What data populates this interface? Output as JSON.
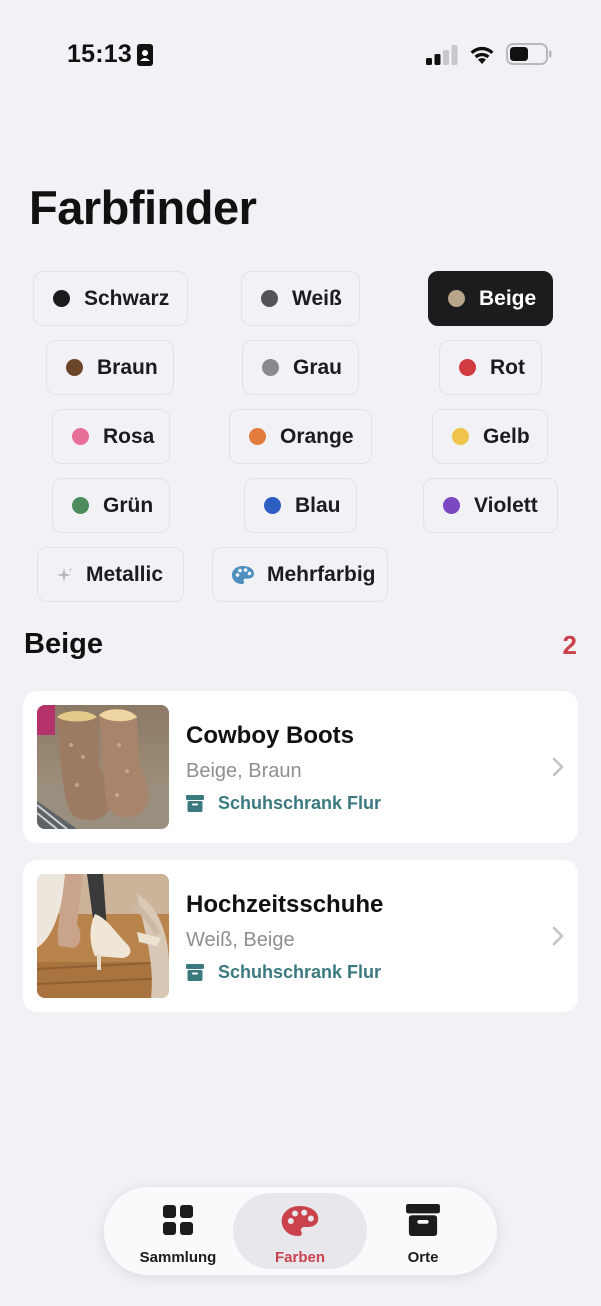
{
  "status_bar": {
    "time": "15:13"
  },
  "title": "Farbfinder",
  "colors": [
    {
      "label": "Schwarz",
      "dot": "#1c1c1e",
      "selected": false
    },
    {
      "label": "Weiß",
      "dot": "#545458",
      "selected": false
    },
    {
      "label": "Beige",
      "dot": "#b8a58a",
      "selected": true
    },
    {
      "label": "Braun",
      "dot": "#6a4528",
      "selected": false
    },
    {
      "label": "Grau",
      "dot": "#8a8a8e",
      "selected": false
    },
    {
      "label": "Rot",
      "dot": "#d13a3f",
      "selected": false
    },
    {
      "label": "Rosa",
      "dot": "#e76f9a",
      "selected": false
    },
    {
      "label": "Orange",
      "dot": "#e27b3b",
      "selected": false
    },
    {
      "label": "Gelb",
      "dot": "#eec44a",
      "selected": false
    },
    {
      "label": "Grün",
      "dot": "#4e8c5e",
      "selected": false
    },
    {
      "label": "Blau",
      "dot": "#2d5ec2",
      "selected": false
    },
    {
      "label": "Violett",
      "dot": "#7b48c2",
      "selected": false
    },
    {
      "label": "Metallic",
      "icon": "sparkle-icon",
      "selected": false
    },
    {
      "label": "Mehrfarbig",
      "icon": "palette-icon",
      "selected": false
    }
  ],
  "section": {
    "title": "Beige",
    "count": "2"
  },
  "items": [
    {
      "name": "Cowboy Boots",
      "colors": "Beige, Braun",
      "location": "Schuhschrank Flur",
      "location_icon": "archive-box-icon"
    },
    {
      "name": "Hochzeitsschuhe",
      "colors": "Weiß, Beige",
      "location": "Schuhschrank Flur",
      "location_icon": "archive-box-icon"
    }
  ],
  "tabs": [
    {
      "label": "Sammlung",
      "icon": "grid-icon",
      "active": false
    },
    {
      "label": "Farben",
      "icon": "palette-icon",
      "active": true
    },
    {
      "label": "Orte",
      "icon": "archive-box-icon",
      "active": false
    }
  ],
  "accent_color": "#c9424c",
  "location_color": "#3a7a7f"
}
